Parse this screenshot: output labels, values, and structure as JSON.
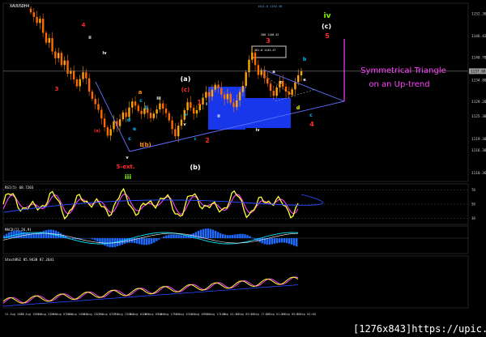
{
  "chart_data": {
    "type": "candlestick",
    "symbol": "XAUUSDH4",
    "title": "Symmetrical Triangle",
    "subtitle": "on an Up-trend",
    "price_axis_labels": [
      "1152.36",
      "1146.42",
      "1140.78",
      "1137.08",
      "1134.80",
      "1129.20",
      "1125.30",
      "1119.30",
      "1116.30",
      "1110.36"
    ],
    "price_ylim": [
      1108,
      1155
    ],
    "x_tick_labels": [
      "24 Aug 2015",
      "25 Aug 15:00",
      "26 Aug 23:00",
      "28 Aug 07:00",
      "31 Aug 15:00",
      "1 Sep 23:00",
      "3 Sep 07:00",
      "4 Sep 15:00",
      "7 Sep 23:00",
      "9 Sep 07:00",
      "10 Sep 15:00",
      "11 Sep 23:00",
      "14 Sep 07:00",
      "15 Sep 15:00",
      "16 Sep 23:00",
      "18 Sep 07:00",
      "19 Sep 15:00",
      "20 Sep 23:00",
      "22 Sep 07:00",
      "23 Sep 15:00",
      "24 Sep 23:00",
      "26 Sep 07:00",
      "27 Sep 15:00",
      "28 Sep 23:00",
      "30 Sep 07:00",
      "1 Oct 15:00",
      "2 Oct 23:00",
      "4 Oct 07:00",
      "5 Oct 15:00",
      "6 Oct 23:00"
    ],
    "x_tick_labels_visible": [
      "24 Aug 2015",
      "25 Aug 15:00",
      "25 Aug 23:00",
      "26 Aug 07:00",
      "26 Aug 15:00",
      "26 Aug 23:00",
      "27 Aug 07:00",
      "27 Aug 15:00",
      "28 Aug 01:00",
      "28 Aug 09:00",
      "28 Aug 17:00",
      "31 Aug 01:00",
      "31 Aug 09:00",
      "31 Aug 17:00",
      "1 Sep 01:00",
      "1 Sep 09:00",
      "1 Sep 17:00",
      "2 Sep 01:00",
      "2 Sep 09:00",
      "3 Sep 03:00"
    ],
    "close_prices": [
      1152.6,
      1151.4,
      1149.8,
      1150.9,
      1147.2,
      1144.6,
      1145.8,
      1142.3,
      1140.5,
      1141.9,
      1138.7,
      1139.9,
      1136.4,
      1137.2,
      1134.9,
      1133.1,
      1135.0,
      1136.8,
      1135.2,
      1131.7,
      1129.8,
      1128.4,
      1126.9,
      1124.6,
      1122.3,
      1120.1,
      1121.8,
      1123.9,
      1122.6,
      1124.4,
      1126.2,
      1125.0,
      1127.5,
      1129.1,
      1128.0,
      1126.6,
      1125.8,
      1127.3,
      1126.1,
      1124.7,
      1125.9,
      1127.0,
      1128.6,
      1127.2,
      1126.0,
      1124.1,
      1121.8,
      1119.9,
      1122.7,
      1124.3,
      1126.8,
      1128.9,
      1127.4,
      1125.9,
      1126.8,
      1128.3,
      1130.1,
      1131.6,
      1130.4,
      1132.2,
      1133.5,
      1132.6,
      1130.9,
      1129.7,
      1131.1,
      1128.8,
      1127.6,
      1129.4,
      1131.6,
      1133.2,
      1136.8,
      1140.1,
      1142.0,
      1138.7,
      1136.1,
      1137.4,
      1135.2,
      1133.8,
      1131.9,
      1130.6,
      1132.8,
      1134.5,
      1133.0,
      1131.7,
      1130.9,
      1132.3,
      1134.2,
      1136.0,
      1137.1
    ],
    "current_price": "1137.08",
    "wave_labels": [
      {
        "text": "3",
        "color": "#ff2a2a"
      },
      {
        "text": "4",
        "color": "#ff2a2a"
      },
      {
        "text": "ii",
        "color": "#ffffff"
      },
      {
        "text": "iv",
        "color": "#ffffff"
      },
      {
        "text": "(a)",
        "color": "#ff2a2a"
      },
      {
        "text": "a",
        "color": "#ff8c00"
      },
      {
        "text": "c",
        "color": "#00bfff"
      },
      {
        "text": "b",
        "color": "#00bfff"
      },
      {
        "text": "d",
        "color": "#00bfff"
      },
      {
        "text": "e",
        "color": "#00bfff"
      },
      {
        "text": "c",
        "color": "#00bfff"
      },
      {
        "text": "v",
        "color": "#ffffff"
      },
      {
        "text": "b",
        "color": "#ff8c00"
      },
      {
        "text": "(b)",
        "color": "#ff8c00"
      },
      {
        "text": "5-ext.",
        "color": "#ff2a2a"
      },
      {
        "text": "iii",
        "color": "#7cfc00"
      },
      {
        "text": "(a)",
        "color": "#ffffff"
      },
      {
        "text": "(c)",
        "color": "#ff2a2a"
      },
      {
        "text": "v",
        "color": "#ffffff"
      },
      {
        "text": "a",
        "color": "#00bfff"
      },
      {
        "text": "c",
        "color": "#00bfff"
      },
      {
        "text": "(b)",
        "color": "#ffffff"
      },
      {
        "text": "1",
        "color": "#ff2a2a"
      },
      {
        "text": "2",
        "color": "#ff2a2a"
      },
      {
        "text": "iii",
        "color": "#ffffff"
      },
      {
        "text": "i",
        "color": "#ffffff"
      },
      {
        "text": "ii",
        "color": "#ffffff"
      },
      {
        "text": "3",
        "color": "#ff2a2a"
      },
      {
        "text": "iv",
        "color": "#ffffff"
      },
      {
        "text": "a",
        "color": "#ffffff"
      },
      {
        "text": "c",
        "color": "#ffffff"
      },
      {
        "text": "iv",
        "color": "#7cfc00"
      },
      {
        "text": "(c)",
        "color": "#ffffff"
      },
      {
        "text": "5",
        "color": "#ff2a2a"
      },
      {
        "text": "b",
        "color": "#00bfff"
      },
      {
        "text": "e",
        "color": "#ffffff"
      },
      {
        "text": "d",
        "color": "#ffff00"
      },
      {
        "text": "c",
        "color": "#00bfff"
      },
      {
        "text": "4",
        "color": "#ff2a2a"
      }
    ],
    "indicator_panels": [
      {
        "name": "RSI(5)",
        "label": "RSI(5) 68.7203",
        "levels": [
          "70",
          "50",
          "30"
        ]
      },
      {
        "name": "MACD",
        "label": "MACD(12,26,9)"
      },
      {
        "name": "StochRSI",
        "label": "StochRSI 85.9438 87.2641"
      }
    ],
    "colors": {
      "background": "#000000",
      "candle": "#ff8c00",
      "box": "#1a3cff",
      "title": "#ff40ff",
      "rsi_line": "#ffff33",
      "rsi_ma": "#ff40ff",
      "trendline": "#6070ff",
      "macd_hist": "#1e6bff"
    }
  },
  "watermark": "[1276x843]https://upic.me/"
}
